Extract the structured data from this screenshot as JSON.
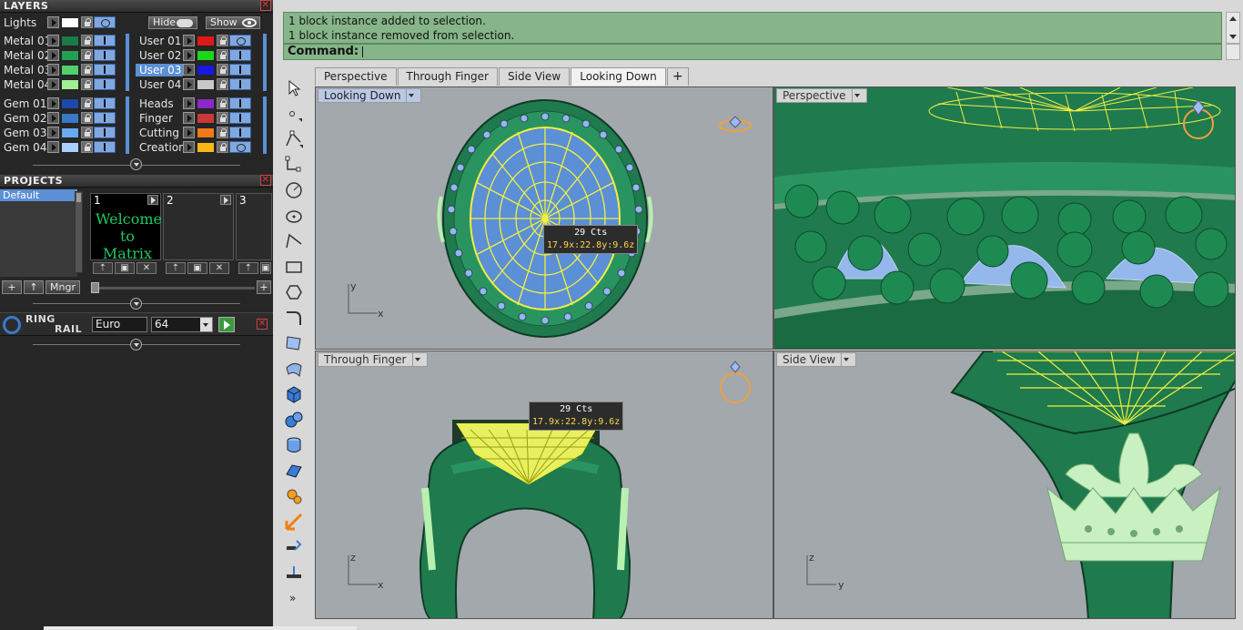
{
  "layers": {
    "title": "LAYERS",
    "lights_label": "Lights",
    "hide_label": "Hide",
    "show_label": "Show",
    "left_rows": [
      {
        "name": "Metal 01",
        "color": "#1b7a45"
      },
      {
        "name": "Metal 02",
        "color": "#22a052"
      },
      {
        "name": "Metal 03",
        "color": "#52d06a"
      },
      {
        "name": "Metal 04",
        "color": "#9ef090"
      },
      {
        "name": "Gem 01",
        "color": "#1c4aa8"
      },
      {
        "name": "Gem 02",
        "color": "#3a78c8"
      },
      {
        "name": "Gem 03",
        "color": "#6aa8f0"
      },
      {
        "name": "Gem 04",
        "color": "#a8d0ff"
      }
    ],
    "right_rows": [
      {
        "name": "User 01",
        "color": "#e01818"
      },
      {
        "name": "User 02",
        "color": "#18d818"
      },
      {
        "name": "User 03",
        "color": "#1818e0",
        "selected": true
      },
      {
        "name": "User 04",
        "color": "#c8c8c8"
      },
      {
        "name": "Heads",
        "color": "#8a28c8"
      },
      {
        "name": "Finger",
        "color": "#c83838"
      },
      {
        "name": "Cutting",
        "color": "#f07818"
      },
      {
        "name": "Creation",
        "color": "#f8b818"
      }
    ]
  },
  "projects": {
    "title": "PROJECTS",
    "list": [
      "Default"
    ],
    "slots": [
      "1",
      "2",
      "3"
    ],
    "welcome_text": "Welcome to Matrix",
    "mngr_label": "Mngr"
  },
  "ring_rail": {
    "title_line1": "RING",
    "title_line2": "RAIL",
    "size_system": "Euro",
    "size_value": "64"
  },
  "command": {
    "history": [
      "1 block instance added to selection.",
      "1 block instance removed from selection."
    ],
    "prompt": "Command:"
  },
  "tabs": [
    "Perspective",
    "Through Finger",
    "Side View",
    "Looking Down"
  ],
  "active_tab": "Looking Down",
  "viewports": {
    "top_left": {
      "label": "Looking Down",
      "axis_x": "x",
      "axis_y": "y"
    },
    "top_right": {
      "label": "Perspective"
    },
    "bottom_left": {
      "label": "Through Finger",
      "axis_x": "x",
      "axis_y": "z"
    },
    "bottom_right": {
      "label": "Side View",
      "axis_x": "y",
      "axis_y": "z"
    }
  },
  "gem_info": {
    "carats": "29",
    "unit": "Cts",
    "dims": "17.9x:22.8y:9.6z"
  },
  "colors": {
    "metal_green": "#1f7a4e",
    "wire_yellow": "#f0f040",
    "gem_blue": "#9bbcf5",
    "viewport_bg": "#a3a8ad",
    "command_bg": "#86b58a"
  }
}
